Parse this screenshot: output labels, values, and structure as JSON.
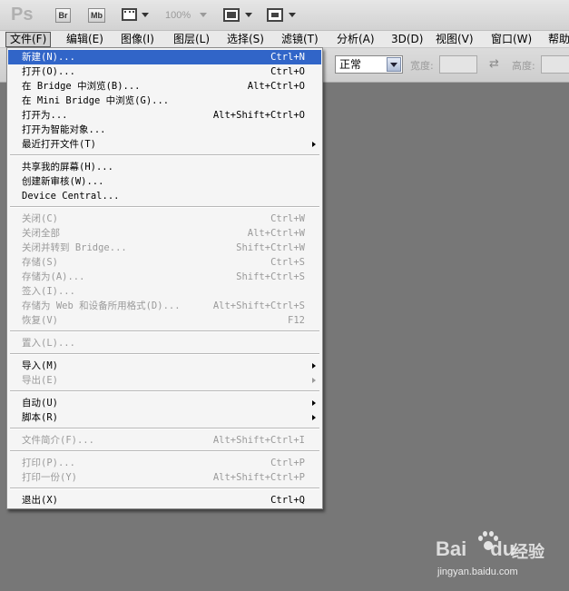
{
  "app": {
    "logo": "Ps",
    "bridge_btn": "Br",
    "minibridge_btn": "Mb",
    "zoom": "100%"
  },
  "menubar": [
    {
      "label": "文件(F)",
      "active": true
    },
    {
      "label": "编辑(E)"
    },
    {
      "label": "图像(I)"
    },
    {
      "label": "图层(L)"
    },
    {
      "label": "选择(S)"
    },
    {
      "label": "滤镜(T)"
    },
    {
      "label": "分析(A)"
    },
    {
      "label": "3D(D)"
    },
    {
      "label": "视图(V)"
    },
    {
      "label": "窗口(W)"
    },
    {
      "label": "帮助"
    }
  ],
  "options": {
    "mode_value": "正常",
    "width_label": "宽度:",
    "height_label": "高度:"
  },
  "file_menu": {
    "items": [
      {
        "label": "新建(N)...",
        "shortcut": "Ctrl+N",
        "highlighted": true
      },
      {
        "label": "打开(O)...",
        "shortcut": "Ctrl+O"
      },
      {
        "label": "在 Bridge 中浏览(B)...",
        "shortcut": "Alt+Ctrl+O"
      },
      {
        "label": "在 Mini Bridge 中浏览(G)...",
        "shortcut": ""
      },
      {
        "label": "打开为...",
        "shortcut": "Alt+Shift+Ctrl+O"
      },
      {
        "label": "打开为智能对象...",
        "shortcut": ""
      },
      {
        "label": "最近打开文件(T)",
        "shortcut": "",
        "submenu": true
      },
      {
        "label": "共享我的屏幕(H)...",
        "shortcut": ""
      },
      {
        "label": "创建新审核(W)...",
        "shortcut": ""
      },
      {
        "label": "Device Central...",
        "shortcut": ""
      },
      {
        "label": "关闭(C)",
        "shortcut": "Ctrl+W",
        "disabled": true
      },
      {
        "label": "关闭全部",
        "shortcut": "Alt+Ctrl+W",
        "disabled": true
      },
      {
        "label": "关闭并转到 Bridge...",
        "shortcut": "Shift+Ctrl+W",
        "disabled": true
      },
      {
        "label": "存储(S)",
        "shortcut": "Ctrl+S",
        "disabled": true
      },
      {
        "label": "存储为(A)...",
        "shortcut": "Shift+Ctrl+S",
        "disabled": true
      },
      {
        "label": "签入(I)...",
        "shortcut": "",
        "disabled": true
      },
      {
        "label": "存储为 Web 和设备所用格式(D)...",
        "shortcut": "Alt+Shift+Ctrl+S",
        "disabled": true
      },
      {
        "label": "恢复(V)",
        "shortcut": "F12",
        "disabled": true
      },
      {
        "label": "置入(L)...",
        "shortcut": "",
        "disabled": true
      },
      {
        "label": "导入(M)",
        "shortcut": "",
        "submenu": true
      },
      {
        "label": "导出(E)",
        "shortcut": "",
        "submenu": true,
        "disabled": true
      },
      {
        "label": "自动(U)",
        "shortcut": "",
        "submenu": true
      },
      {
        "label": "脚本(R)",
        "shortcut": "",
        "submenu": true
      },
      {
        "label": "文件简介(F)...",
        "shortcut": "Alt+Shift+Ctrl+I",
        "disabled": true
      },
      {
        "label": "打印(P)...",
        "shortcut": "Ctrl+P",
        "disabled": true
      },
      {
        "label": "打印一份(Y)",
        "shortcut": "Alt+Shift+Ctrl+P",
        "disabled": true
      },
      {
        "label": "退出(X)",
        "shortcut": "Ctrl+Q"
      }
    ]
  },
  "watermark": {
    "brand": "Bai",
    "brand_suffix": "du",
    "cn": "经验",
    "url": "jingyan.baidu.com"
  },
  "colors": {
    "workspace": "#777777",
    "menu_highlight": "#3165c8"
  }
}
